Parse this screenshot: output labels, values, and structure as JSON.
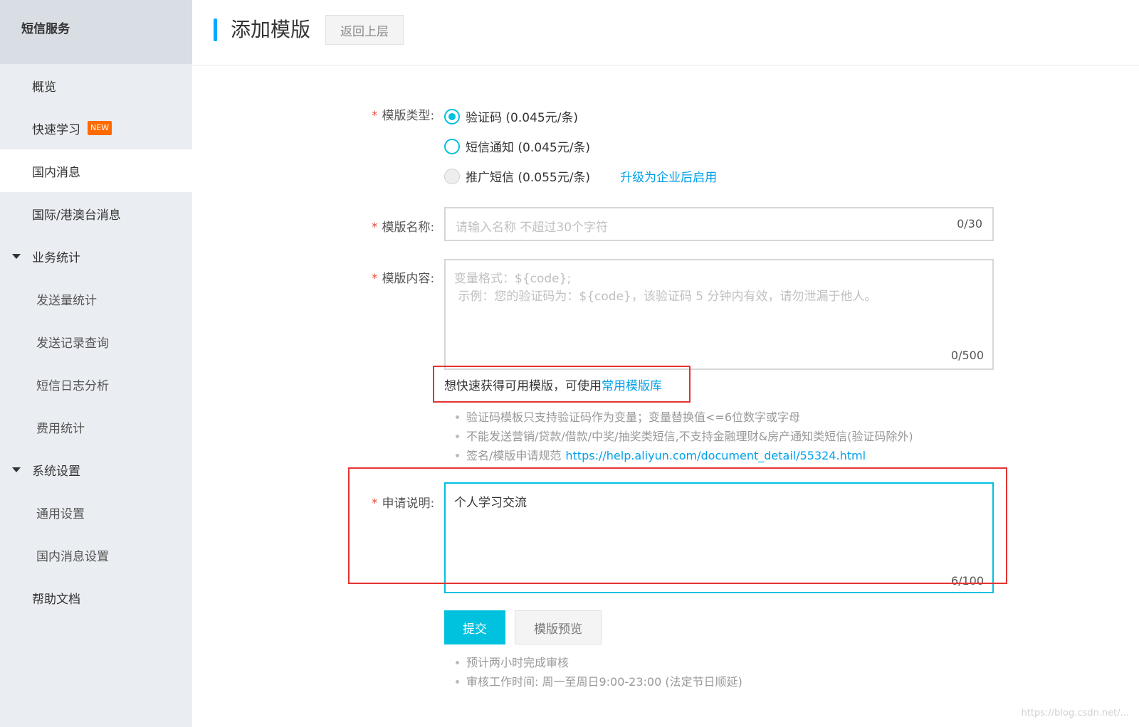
{
  "sidebar": {
    "title": "短信服务",
    "items": [
      {
        "label": "概览"
      },
      {
        "label": "快速学习",
        "badge": "NEW"
      },
      {
        "label": "国内消息"
      },
      {
        "label": "国际/港澳台消息"
      },
      {
        "label": "业务统计"
      },
      {
        "label": "发送量统计"
      },
      {
        "label": "发送记录查询"
      },
      {
        "label": "短信日志分析"
      },
      {
        "label": "费用统计"
      },
      {
        "label": "系统设置"
      },
      {
        "label": "通用设置"
      },
      {
        "label": "国内消息设置"
      },
      {
        "label": "帮助文档"
      }
    ]
  },
  "header": {
    "title": "添加模版",
    "back_label": "返回上层"
  },
  "form": {
    "required_mark": "*",
    "type_label": "模版类型:",
    "type_options": [
      {
        "label": "验证码 (0.045元/条)",
        "state": "checked"
      },
      {
        "label": "短信通知 (0.045元/条)",
        "state": "unchecked"
      },
      {
        "label": "推广短信 (0.055元/条)",
        "state": "disabled"
      }
    ],
    "upgrade_link": "升级为企业后启用",
    "name_label": "模版名称:",
    "name_placeholder": "请输入名称 不超过30个字符",
    "name_counter": "0/30",
    "content_label": "模版内容:",
    "content_placeholder_line1": "变量格式：${code};",
    "content_placeholder_line2": " 示例：您的验证码为：${code}，该验证码 5 分钟内有效，请勿泄漏于他人。",
    "content_counter": "0/500",
    "quick_hint_text": "想快速获得可用模版，可使用",
    "quick_hint_link": "常用模版库",
    "rules": [
      "验证码模板只支持验证码作为变量；变量替换值<=6位数字或字母",
      "不能发送营销/贷款/借款/中奖/抽奖类短信,不支持金融理财&房产通知类短信(验证码除外)"
    ],
    "rule_spec_text": "签名/模版申请规范",
    "rule_spec_link": "https://help.aliyun.com/document_detail/55324.html",
    "remark_label": "申请说明:",
    "remark_value": "个人学习交流",
    "remark_counter": "6/100",
    "submit_label": "提交",
    "preview_label": "模版预览",
    "notes": [
      "预计两小时完成审核",
      "审核工作时间: 周一至周日9:00-23:00 (法定节日顺延)"
    ]
  },
  "watermark": "https://blog.csdn.net/...",
  "colors": {
    "accent": "#00c1de",
    "link": "#00a0e9",
    "required": "#e74c3c",
    "highlight_box": "#e53333",
    "badge": "#ff6a00"
  }
}
